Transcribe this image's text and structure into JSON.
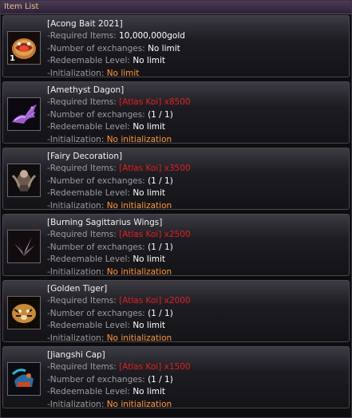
{
  "window": {
    "title": "Item List"
  },
  "labels": {
    "required": "-Required Items:",
    "exchanges": "-Number of exchanges:",
    "level": "-Redeemable Level:",
    "init": "-Initialization:"
  },
  "items": [
    {
      "name": "[Acong Bait 2021]",
      "quantity": "1",
      "required": "10,000,000gold",
      "exchanges": "No limit",
      "level": "No limit",
      "init": "No limit",
      "icon": "bait-icon"
    },
    {
      "name": "[Amethyst Dagon]",
      "required": "[Atlas Koi] x8500",
      "exchanges": "(1 / 1)",
      "level": "No limit",
      "init": "No initialization",
      "icon": "dragon-icon"
    },
    {
      "name": "[Fairy Decoration]",
      "required": "[Atlas Koi] x3500",
      "exchanges": "(1 / 1)",
      "level": "No limit",
      "init": "No initialization",
      "icon": "fairy-icon"
    },
    {
      "name": "[Burning Sagittarius Wings]",
      "required": "[Atlas Koi] x2500",
      "exchanges": "(1 / 1)",
      "level": "No limit",
      "init": "No initialization",
      "icon": "wings-icon"
    },
    {
      "name": "[Golden Tiger]",
      "required": "[Atlas Koi] x2000",
      "exchanges": "(1 / 1)",
      "level": "No limit",
      "init": "No initialization",
      "icon": "tiger-icon"
    },
    {
      "name": "[Jiangshi Cap]",
      "required": "[Atlas Koi] x1500",
      "exchanges": "(1 / 1)",
      "level": "No limit",
      "init": "No initialization",
      "icon": "cap-icon"
    }
  ],
  "colors": {
    "title": "#e9c58a",
    "label": "#9d9ca2",
    "required_red": "#e02020",
    "init_orange": "#ff9a3c"
  }
}
